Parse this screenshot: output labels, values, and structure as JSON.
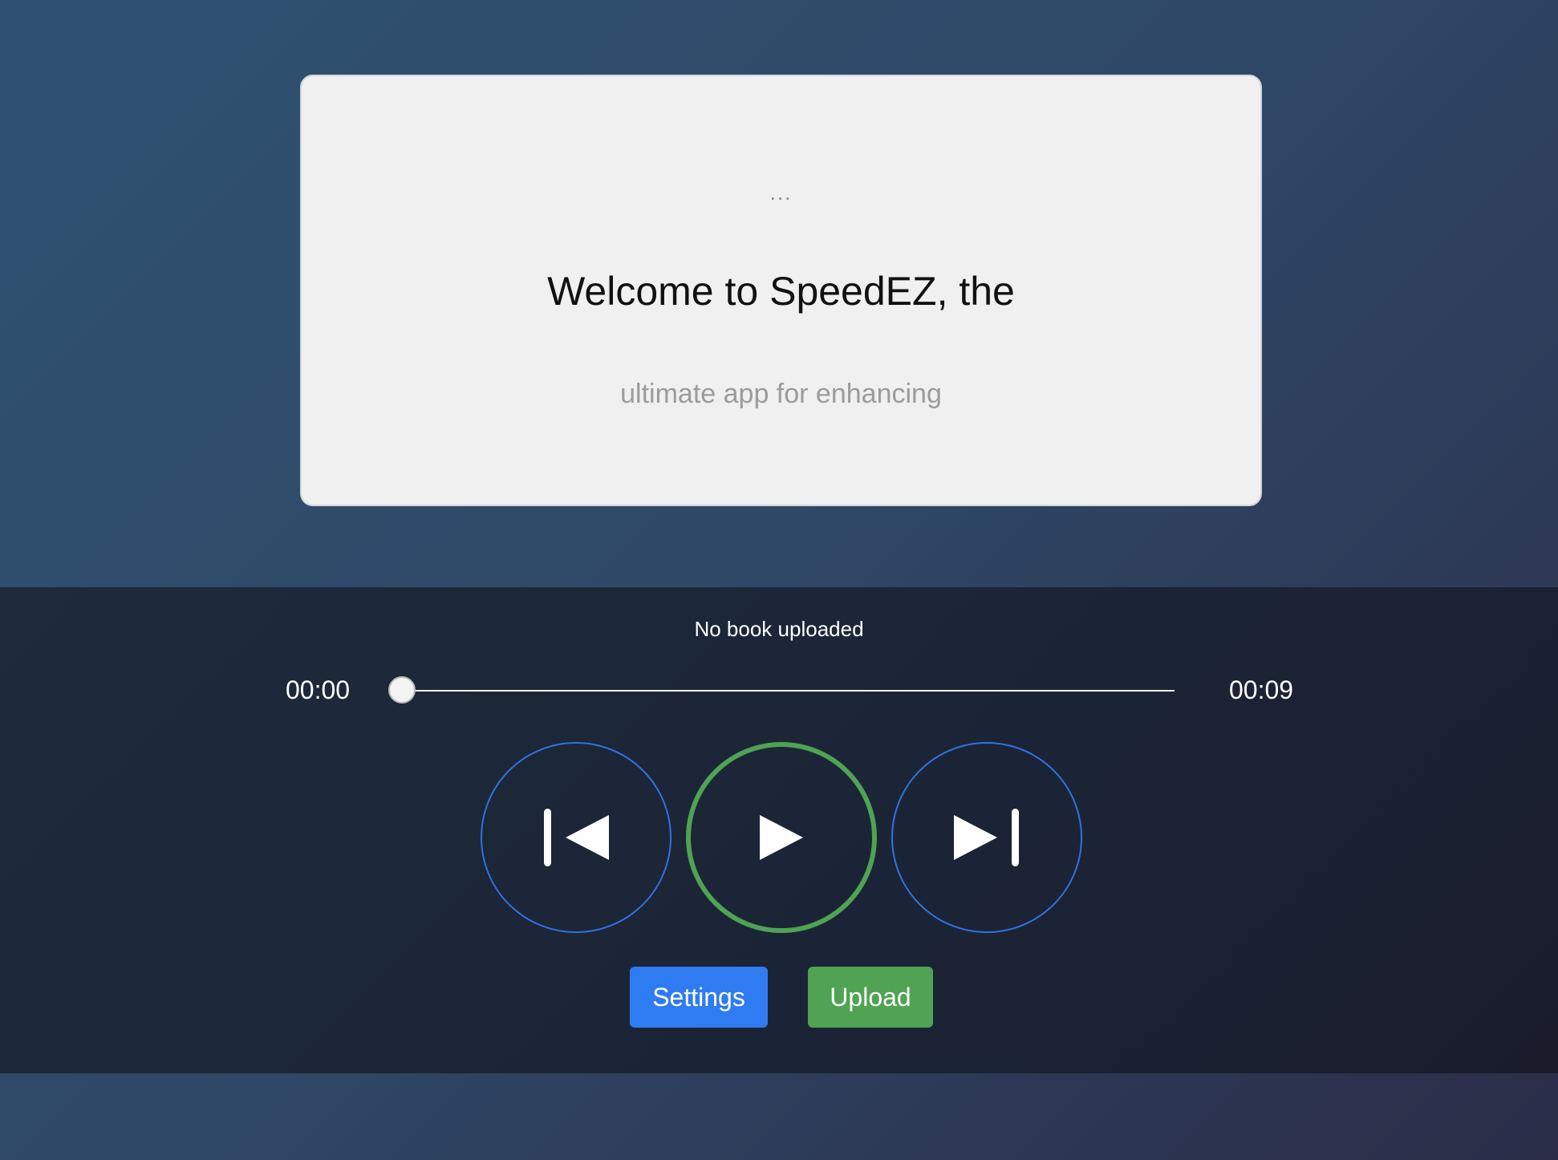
{
  "reader": {
    "previous_word": "...",
    "current_text": "Welcome to SpeedEZ, the",
    "next_text": "ultimate app for enhancing"
  },
  "player": {
    "book_status": "No book uploaded",
    "elapsed_time": "00:00",
    "total_time": "00:09",
    "progress_fraction": 0,
    "controls": {
      "previous_icon": "skip-previous-icon",
      "play_icon": "play-icon",
      "next_icon": "skip-next-icon"
    },
    "settings_label": "Settings",
    "upload_label": "Upload"
  },
  "colors": {
    "accent_blue": "#2f7bf1",
    "accent_green": "#4fa352",
    "card_background": "#f0f0f0",
    "player_background": "#1b2436"
  }
}
